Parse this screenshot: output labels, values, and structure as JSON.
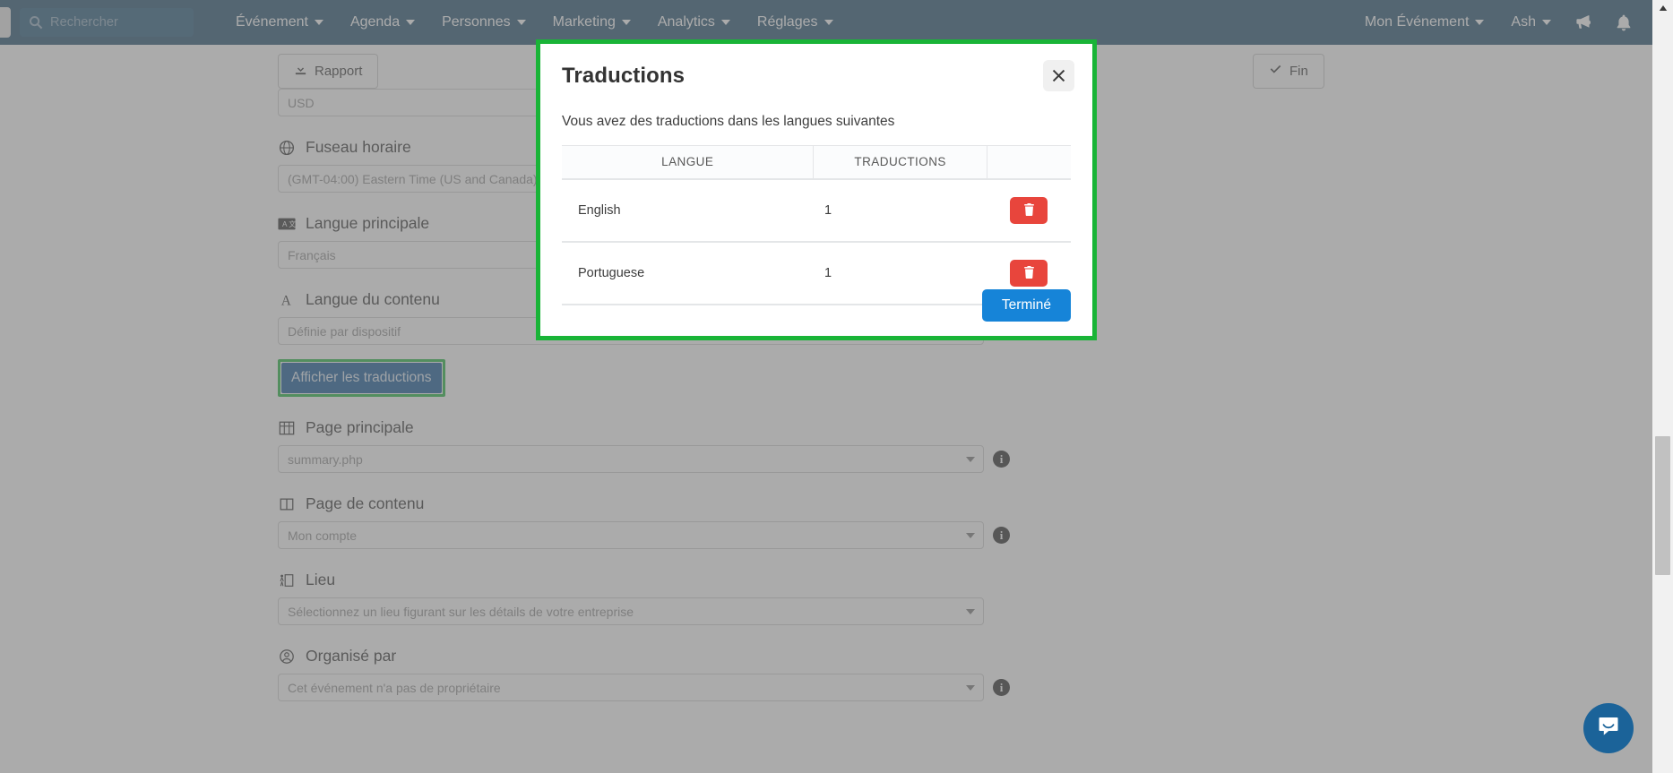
{
  "navbar": {
    "search": {
      "placeholder": "Rechercher",
      "icon": "search-icon"
    },
    "items": [
      {
        "label": "Événement",
        "caret": true
      },
      {
        "label": "Agenda",
        "caret": true
      },
      {
        "label": "Personnes",
        "caret": true
      },
      {
        "label": "Marketing",
        "caret": true
      },
      {
        "label": "Analytics",
        "caret": true
      },
      {
        "label": "Réglages",
        "caret": true
      }
    ],
    "right_items": [
      {
        "label": "Mon Événement",
        "caret": true
      },
      {
        "label": "Ash",
        "caret": true
      }
    ],
    "icons": [
      {
        "name": "megaphone-icon"
      },
      {
        "name": "bell-icon"
      }
    ],
    "background_color": "#1b4a6b"
  },
  "toolbar": {
    "report_label": "Rapport",
    "report_icon": "download-icon",
    "done_label": "Fin",
    "done_icon": "check-icon"
  },
  "form": {
    "fields": [
      {
        "label": "",
        "icon": "",
        "value": "USD",
        "has_info": false,
        "has_label": false
      },
      {
        "label": "Fuseau horaire",
        "icon": "globe-icon",
        "value": "(GMT-04:00) Eastern Time (US and Canada)",
        "has_info": false,
        "has_label": true
      },
      {
        "label": "Langue principale",
        "icon": "translate-icon",
        "value": "Français",
        "has_info": false,
        "has_label": true
      },
      {
        "label": "Langue du contenu",
        "icon": "letter-a-icon",
        "value": "Définie par dispositif",
        "has_info": false,
        "has_label": true
      },
      {
        "label": "Page principale",
        "icon": "grid-icon",
        "value": "summary.php",
        "has_info": true,
        "has_label": true
      },
      {
        "label": "Page de contenu",
        "icon": "columns-icon",
        "value": "Mon compte",
        "has_info": true,
        "has_label": true
      },
      {
        "label": "Lieu",
        "icon": "venue-icon",
        "value": "Sélectionnez un lieu figurant sur les détails de votre entreprise",
        "has_info": false,
        "has_label": true
      },
      {
        "label": "Organisé par",
        "icon": "user-circle-icon",
        "value": "Cet événement n'a pas de propriétaire",
        "has_info": true,
        "has_label": true
      }
    ],
    "show_translations_button": "Afficher les traductions"
  },
  "modal": {
    "title": "Traductions",
    "subtitle": "Vous avez des traductions dans les langues suivantes",
    "close_icon": "close-icon",
    "border_color": "#19b437",
    "table": {
      "headers": [
        "LANGUE",
        "TRADUCTIONS",
        ""
      ],
      "rows": [
        {
          "language": "English",
          "translations": "1",
          "action_icon": "trash-icon"
        },
        {
          "language": "Portuguese",
          "translations": "1",
          "action_icon": "trash-icon"
        }
      ]
    },
    "done_button": "Terminé",
    "done_button_color": "#1684d8",
    "delete_button_color": "#e8453c"
  },
  "intercom": {
    "icon": "chat-bubble-icon",
    "color": "#1b6399"
  },
  "scrollbar": {
    "up_arrow_icon": "caret-up-icon"
  }
}
